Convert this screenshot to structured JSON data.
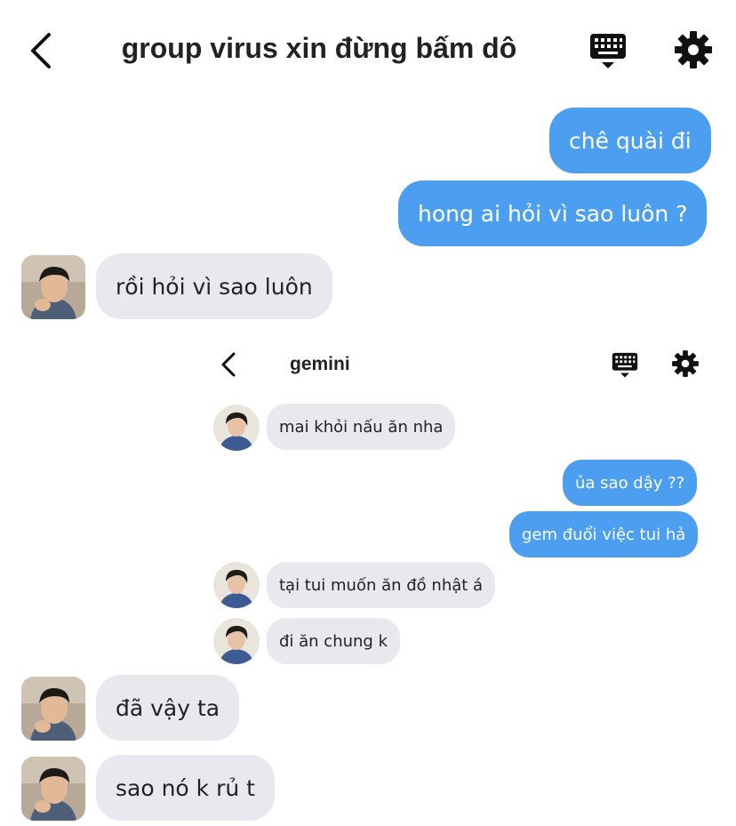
{
  "header": {
    "title": "group virus xin đừng bấm dô"
  },
  "messages": [
    {
      "text": "chê quài đi",
      "from": "me"
    },
    {
      "text": "hong ai hỏi vì sao luôn ?",
      "from": "me"
    },
    {
      "text": "rồi hỏi vì sao luôn",
      "from": "other"
    },
    {
      "text": "đã vậy ta",
      "from": "other"
    },
    {
      "text": "sao nó k rủ t",
      "from": "other"
    }
  ],
  "embedded": {
    "title": "gemini",
    "messages": [
      {
        "text": "mai khỏi nấu ăn nha",
        "from": "other"
      },
      {
        "text": "ủa sao dậy ??",
        "from": "me"
      },
      {
        "text": "gem đuổi việc tui hả",
        "from": "me"
      },
      {
        "text": "tại tui muốn ăn đồ nhật á",
        "from": "other"
      },
      {
        "text": "đi ăn chung k",
        "from": "other"
      }
    ]
  },
  "colors": {
    "outgoing_bubble": "#4b9ef0",
    "incoming_bubble": "#e8e9ee"
  },
  "icons": [
    "back-icon",
    "keyboard-icon",
    "gear-icon",
    "avatar"
  ]
}
